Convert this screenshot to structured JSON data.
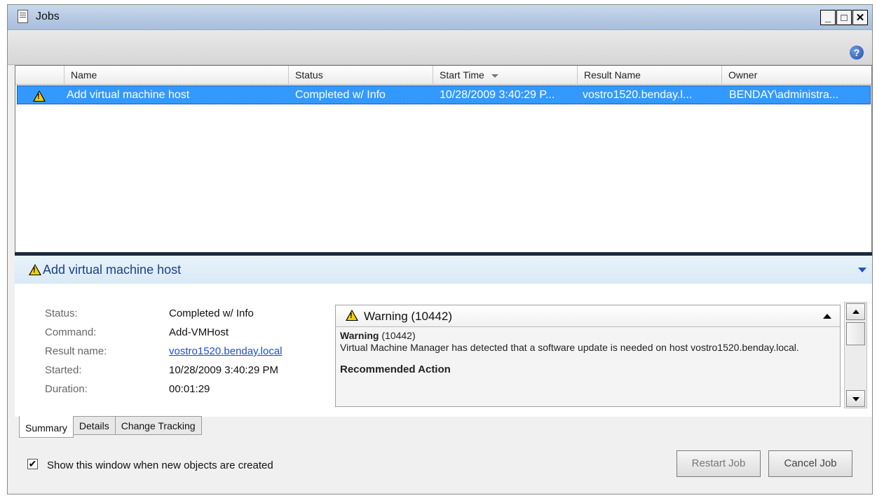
{
  "window": {
    "title": "Jobs",
    "minimize": "_",
    "maximize": "□",
    "close": "✕"
  },
  "toolbar": {
    "help": "?"
  },
  "grid": {
    "columns": [
      "Name",
      "Status",
      "Start Time",
      "Result Name",
      "Owner"
    ],
    "rows": [
      {
        "name": "Add virtual machine host",
        "status": "Completed w/ Info",
        "start_time": "10/28/2009 3:40:29 P...",
        "result_name": "vostro1520.benday.l...",
        "owner": "BENDAY\\administra..."
      }
    ]
  },
  "details": {
    "title": "Add virtual machine host",
    "fields": [
      {
        "label": "Status:",
        "value": "Completed w/ Info"
      },
      {
        "label": "Command:",
        "value": "Add-VMHost"
      },
      {
        "label": "Result name:",
        "value": "vostro1520.benday.local"
      },
      {
        "label": "Started:",
        "value": "10/28/2009 3:40:29 PM"
      },
      {
        "label": "Duration:",
        "value": "00:01:29"
      }
    ],
    "message": {
      "header": "Warning (10442)",
      "heading_bold": "Warning",
      "heading_code": "(10442)",
      "text": "Virtual Machine Manager has detected that a software update is needed on host vostro1520.benday.local.",
      "recommended": "Recommended Action"
    }
  },
  "tabs": [
    "Summary",
    "Details",
    "Change Tracking"
  ],
  "footer": {
    "checkbox_label": "Show this window when new objects are created",
    "checked": true,
    "restart_label": "Restart Job",
    "cancel_label": "Cancel Job"
  },
  "colors": {
    "selection": "#3399ff",
    "title_gradient": "#b6c9e3",
    "details_title": "#1e3f8a",
    "link": "#1a4fd6",
    "warning": "#f5d000"
  },
  "icons": [
    "document-icon",
    "help-icon",
    "warning-icon",
    "sort-desc-icon",
    "collapse-icon",
    "checkbox-icon"
  ]
}
